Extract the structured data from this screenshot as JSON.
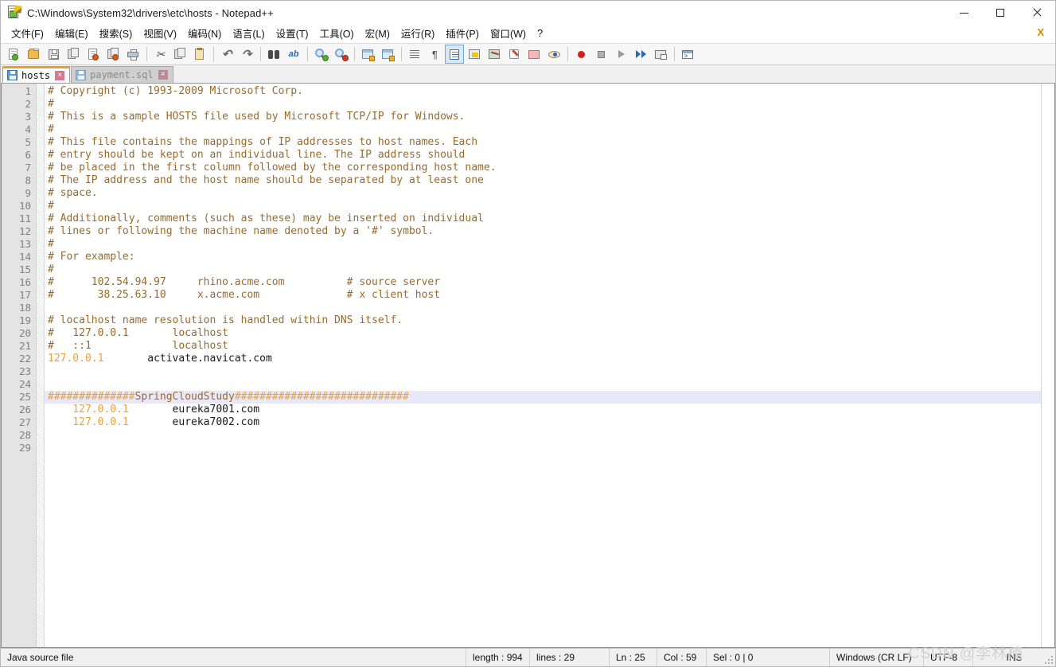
{
  "window": {
    "title": "C:\\Windows\\System32\\drivers\\etc\\hosts - Notepad++",
    "icon": "notepadpp-icon",
    "controls": {
      "minimize": "minimize-button",
      "maximize": "maximize-button",
      "close": "close-button"
    }
  },
  "menubar": {
    "items": [
      {
        "label": "文件(F)",
        "name": "menu-file"
      },
      {
        "label": "编辑(E)",
        "name": "menu-edit"
      },
      {
        "label": "搜索(S)",
        "name": "menu-search"
      },
      {
        "label": "视图(V)",
        "name": "menu-view"
      },
      {
        "label": "编码(N)",
        "name": "menu-encoding"
      },
      {
        "label": "语言(L)",
        "name": "menu-language"
      },
      {
        "label": "设置(T)",
        "name": "menu-settings"
      },
      {
        "label": "工具(O)",
        "name": "menu-tools"
      },
      {
        "label": "宏(M)",
        "name": "menu-macro"
      },
      {
        "label": "运行(R)",
        "name": "menu-run"
      },
      {
        "label": "插件(P)",
        "name": "menu-plugins"
      },
      {
        "label": "窗口(W)",
        "name": "menu-window"
      },
      {
        "label": "?",
        "name": "menu-help"
      }
    ],
    "close_document_label": "X"
  },
  "toolbar": {
    "icons": [
      "new-file-icon",
      "open-file-icon",
      "save-icon",
      "save-all-icon",
      "close-file-icon",
      "close-all-files-icon",
      "print-icon",
      "sep",
      "cut-icon",
      "copy-icon",
      "paste-icon",
      "sep",
      "undo-icon",
      "redo-icon",
      "sep",
      "find-icon",
      "replace-icon",
      "sep",
      "zoom-in-icon",
      "zoom-out-icon",
      "sep",
      "sync-vertical-scroll-icon",
      "sync-horizontal-scroll-icon",
      "sep",
      "word-wrap-icon",
      "show-all-characters-icon",
      "sep",
      "show-indent-guide-icon",
      "user-defined-language-icon",
      "document-map-icon",
      "function-list-icon",
      "folder-as-workspace-icon",
      "document-preview-icon",
      "sep",
      "record-macro-icon",
      "stop-recording-icon",
      "playback-macro-icon",
      "run-macro-multiple-icon",
      "save-macro-icon",
      "sep",
      "run-icon"
    ],
    "active_icon": "word-wrap-icon"
  },
  "tabs": [
    {
      "label": "hosts",
      "active": true,
      "name": "tab-hosts",
      "close": "×"
    },
    {
      "label": "payment.sql",
      "active": false,
      "name": "tab-payment-sql",
      "close": "×"
    }
  ],
  "editor": {
    "current_line": 25,
    "total_lines": 29,
    "lines": [
      {
        "n": 1,
        "segments": [
          {
            "t": "# Copyright (c) 1993-2009 Microsoft Corp.",
            "c": "tok-comment"
          }
        ]
      },
      {
        "n": 2,
        "segments": [
          {
            "t": "#",
            "c": "tok-comment"
          }
        ]
      },
      {
        "n": 3,
        "segments": [
          {
            "t": "# This is a sample HOSTS file used by Microsoft TCP/IP for Windows.",
            "c": "tok-comment"
          }
        ]
      },
      {
        "n": 4,
        "segments": [
          {
            "t": "#",
            "c": "tok-comment"
          }
        ]
      },
      {
        "n": 5,
        "segments": [
          {
            "t": "# This file contains the mappings of IP addresses to host names. Each",
            "c": "tok-comment"
          }
        ]
      },
      {
        "n": 6,
        "segments": [
          {
            "t": "# entry should be kept on an individual line. The IP address should",
            "c": "tok-comment"
          }
        ]
      },
      {
        "n": 7,
        "segments": [
          {
            "t": "# be placed in the first column followed by the corresponding host name.",
            "c": "tok-comment"
          }
        ]
      },
      {
        "n": 8,
        "segments": [
          {
            "t": "# The IP address and the host name should be separated by at least one",
            "c": "tok-comment"
          }
        ]
      },
      {
        "n": 9,
        "segments": [
          {
            "t": "# space.",
            "c": "tok-comment"
          }
        ]
      },
      {
        "n": 10,
        "segments": [
          {
            "t": "#",
            "c": "tok-comment"
          }
        ]
      },
      {
        "n": 11,
        "segments": [
          {
            "t": "# Additionally, comments (such as these) may be inserted on individual",
            "c": "tok-comment"
          }
        ]
      },
      {
        "n": 12,
        "segments": [
          {
            "t": "# lines or following the machine name denoted by a '#' symbol.",
            "c": "tok-comment"
          }
        ]
      },
      {
        "n": 13,
        "segments": [
          {
            "t": "#",
            "c": "tok-comment"
          }
        ]
      },
      {
        "n": 14,
        "segments": [
          {
            "t": "# For example:",
            "c": "tok-comment"
          }
        ]
      },
      {
        "n": 15,
        "segments": [
          {
            "t": "#",
            "c": "tok-comment"
          }
        ]
      },
      {
        "n": 16,
        "segments": [
          {
            "t": "#      102.54.94.97     rhino.acme.com          # source server",
            "c": "tok-comment"
          }
        ]
      },
      {
        "n": 17,
        "segments": [
          {
            "t": "#       38.25.63.10     x.acme.com              # x client host",
            "c": "tok-comment"
          }
        ]
      },
      {
        "n": 18,
        "segments": [
          {
            "t": "",
            "c": "tok-host"
          }
        ]
      },
      {
        "n": 19,
        "segments": [
          {
            "t": "# localhost name resolution is handled within DNS itself.",
            "c": "tok-comment"
          }
        ]
      },
      {
        "n": 20,
        "segments": [
          {
            "t": "#   127.0.0.1       localhost",
            "c": "tok-comment"
          }
        ]
      },
      {
        "n": 21,
        "segments": [
          {
            "t": "#   ::1             localhost",
            "c": "tok-comment"
          }
        ]
      },
      {
        "n": 22,
        "segments": [
          {
            "t": "127.0.0.1",
            "c": "tok-ip"
          },
          {
            "t": "       activate.navicat.com",
            "c": "tok-host"
          }
        ]
      },
      {
        "n": 23,
        "segments": [
          {
            "t": "",
            "c": "tok-host"
          }
        ]
      },
      {
        "n": 24,
        "segments": [
          {
            "t": "",
            "c": "tok-host"
          }
        ]
      },
      {
        "n": 25,
        "current": true,
        "segments": [
          {
            "t": "##############",
            "c": "tok-ip"
          },
          {
            "t": "SpringCloudStudy",
            "c": "tok-comment"
          },
          {
            "t": "############################",
            "c": "tok-ip"
          }
        ]
      },
      {
        "n": 26,
        "segments": [
          {
            "t": "    127.0.0.1",
            "c": "tok-ip"
          },
          {
            "t": "       eureka7001.com",
            "c": "tok-host"
          }
        ]
      },
      {
        "n": 27,
        "segments": [
          {
            "t": "    127.0.0.1",
            "c": "tok-ip"
          },
          {
            "t": "       eureka7002.com",
            "c": "tok-host"
          }
        ]
      },
      {
        "n": 28,
        "segments": [
          {
            "t": "",
            "c": "tok-host"
          }
        ]
      },
      {
        "n": 29,
        "segments": [
          {
            "t": "",
            "c": "tok-host"
          }
        ]
      }
    ]
  },
  "statusbar": {
    "doc_type": "Java source file",
    "length": "length : 994",
    "lines": "lines : 29",
    "ln": "Ln : 25",
    "col": "Col : 59",
    "sel": "Sel : 0 | 0",
    "eol": "Windows (CR LF)",
    "encoding": "UTF-8",
    "insert_mode": "INS"
  },
  "watermark": {
    "text": "CSDN @李林楠"
  },
  "colors": {
    "comment": "#9a6a2a",
    "ip": "#e8a33d",
    "current_line_bg": "#e8e8f8",
    "tab_active_accent": "#ec9f2e",
    "gutter_bg": "#e4e4e4"
  }
}
